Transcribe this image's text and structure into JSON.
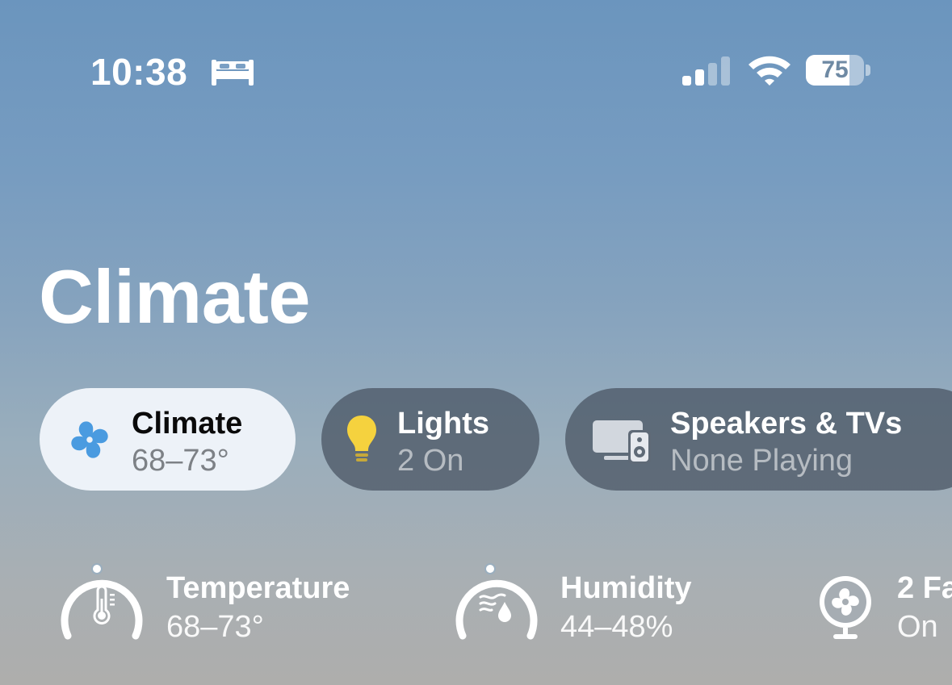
{
  "status_bar": {
    "time": "10:38",
    "focus_icon": "bed-icon",
    "signal_icon": "cellular-signal-icon",
    "wifi_icon": "wifi-icon",
    "battery_percent": "75",
    "battery_level": 0.75
  },
  "page": {
    "title": "Climate"
  },
  "categories": [
    {
      "title": "Climate",
      "subtitle": "68–73°",
      "icon": "fan-icon",
      "selected": true,
      "color": "#4a9be0"
    },
    {
      "title": "Lights",
      "subtitle": "2 On",
      "icon": "lightbulb-icon",
      "selected": false,
      "color": "#f5d23e"
    },
    {
      "title": "Speakers & TVs",
      "subtitle": "None Playing",
      "icon": "tv-speaker-icon",
      "selected": false
    }
  ],
  "sensors": [
    {
      "title": "Temperature",
      "value": "68–73°",
      "icon": "thermometer-icon"
    },
    {
      "title": "Humidity",
      "value": "44–48%",
      "icon": "humidity-icon"
    },
    {
      "title": "2 Fa",
      "value": "On",
      "icon": "fan-icon"
    }
  ]
}
